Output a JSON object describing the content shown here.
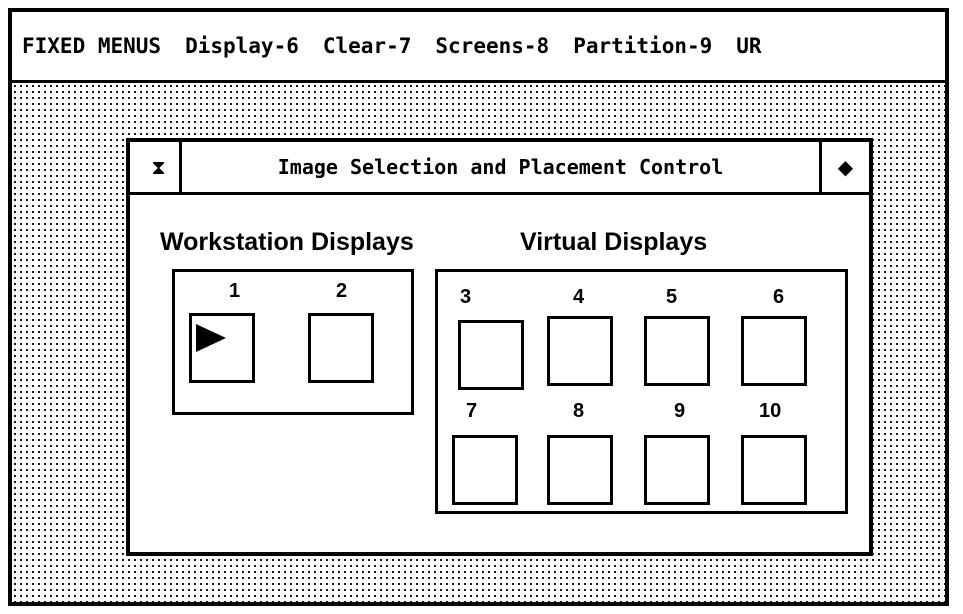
{
  "menubar": {
    "fixed_menus": "FIXED MENUS",
    "display": "Display-6",
    "clear": "Clear-7",
    "screens": "Screens-8",
    "partition": "Partition-9",
    "ur": "UR"
  },
  "window": {
    "close_glyph": "⧗",
    "title": "Image Selection and Placement Control",
    "zoom_glyph": "◆"
  },
  "workstation": {
    "label": "Workstation Displays",
    "slots": [
      "1",
      "2"
    ]
  },
  "virtual": {
    "label": "Virtual Displays",
    "slots": [
      "3",
      "4",
      "5",
      "6",
      "7",
      "8",
      "9",
      "10"
    ]
  },
  "icons": {
    "pointer": "selection-pointer-icon",
    "close": "close-box-icon",
    "zoom": "zoom-box-icon"
  }
}
